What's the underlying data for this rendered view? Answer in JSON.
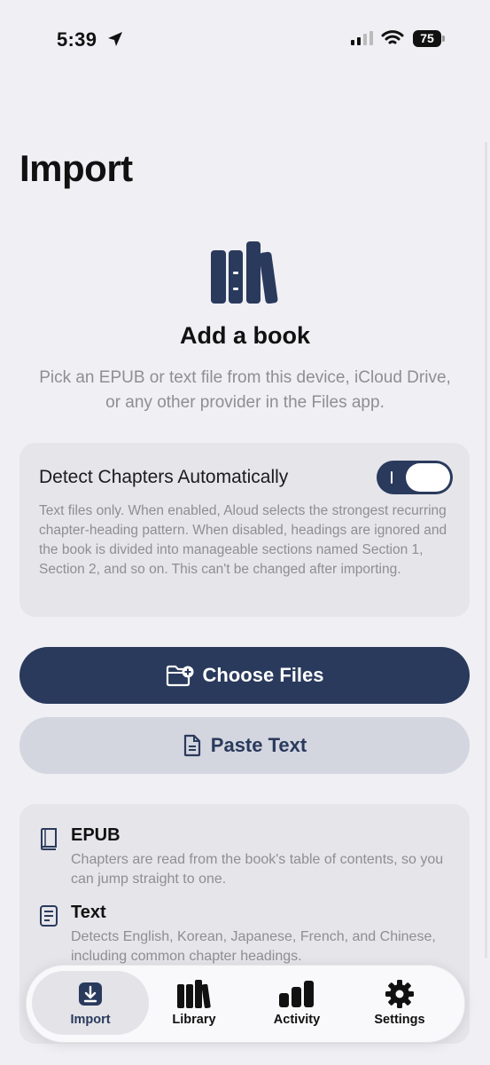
{
  "status_bar": {
    "time": "5:39",
    "battery": "75"
  },
  "page": {
    "title": "Import"
  },
  "hero": {
    "title": "Add a book",
    "description": "Pick an EPUB or text file from this device, iCloud Drive, or any other provider in the Files app."
  },
  "settings": {
    "toggle_label": "Detect Chapters Automatically",
    "toggle_on": true,
    "toggle_description": "Text files only. When enabled, Aloud selects the strongest recurring chapter-heading pattern. When disabled, headings are ignored and the book is divided into manageable sections named Section 1, Section 2, and so on. This can't be changed after importing."
  },
  "actions": {
    "choose_files": "Choose Files",
    "paste_text": "Paste Text"
  },
  "formats": [
    {
      "title": "EPUB",
      "description": "Chapters are read from the book's table of contents, so you can jump straight to one.",
      "icon": "book-icon"
    },
    {
      "title": "Text",
      "description": "Detects English, Korean, Japanese, French, and Chinese, including common chapter headings.",
      "icon": "text-document-icon"
    }
  ],
  "tabs": [
    {
      "label": "Import",
      "icon": "import-tray-icon",
      "active": true
    },
    {
      "label": "Library",
      "icon": "books-icon",
      "active": false
    },
    {
      "label": "Activity",
      "icon": "bar-chart-icon",
      "active": false
    },
    {
      "label": "Settings",
      "icon": "gear-icon",
      "active": false
    }
  ],
  "colors": {
    "accent": "#2a3a5c",
    "background": "#efeff4",
    "card": "#e5e5ea",
    "secondary_text": "#8e8e93"
  }
}
